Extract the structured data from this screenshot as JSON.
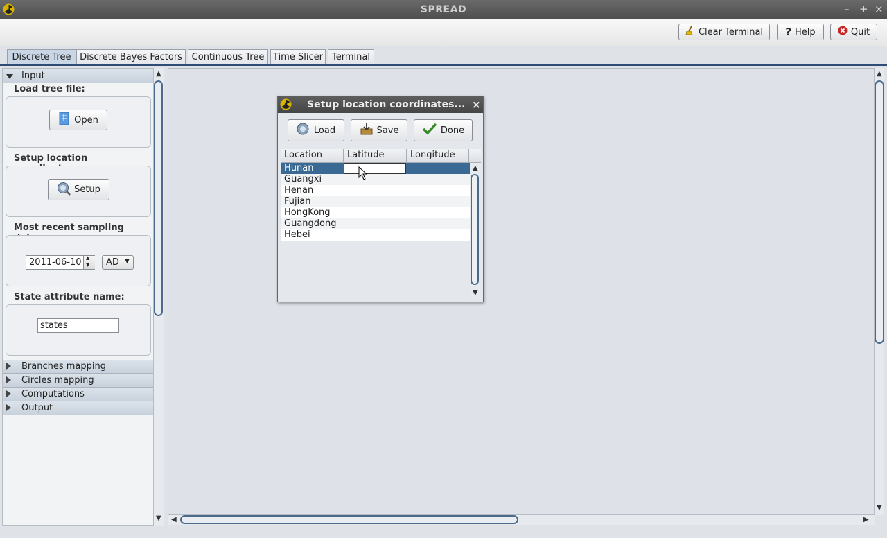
{
  "window": {
    "title": "SPREAD",
    "controls": [
      "–",
      "+",
      "×"
    ]
  },
  "toolbar": {
    "clear_terminal": "Clear Terminal",
    "help": "Help",
    "quit": "Quit"
  },
  "tabs": [
    {
      "label": "Discrete Tree",
      "active": true
    },
    {
      "label": "Discrete Bayes Factors",
      "active": false
    },
    {
      "label": "Continuous Tree",
      "active": false
    },
    {
      "label": "Time Slicer",
      "active": false
    },
    {
      "label": "Terminal",
      "active": false
    }
  ],
  "left_panel": {
    "input_header": "Input",
    "load_tree_label": "Load tree file:",
    "open_button": "Open",
    "setup_coords_label": "Setup location coordinates:",
    "setup_button": "Setup",
    "sampling_date_label": "Most recent sampling date:",
    "sampling_date_value": "2011-06-10",
    "era_value": "AD",
    "state_attr_label": "State attribute name:",
    "state_attr_value": "states",
    "collapsed_sections": [
      "Branches mapping",
      "Circles mapping",
      "Computations",
      "Output"
    ]
  },
  "dialog": {
    "title": "Setup location coordinates...",
    "close": "×",
    "buttons": {
      "load": "Load",
      "save": "Save",
      "done": "Done"
    },
    "columns": [
      "Location",
      "Latitude",
      "Longitude"
    ],
    "rows": [
      {
        "location": "Hunan",
        "latitude": "",
        "longitude": "",
        "selected": true
      },
      {
        "location": "Guangxi",
        "latitude": "",
        "longitude": ""
      },
      {
        "location": "Henan",
        "latitude": "",
        "longitude": ""
      },
      {
        "location": "Fujian",
        "latitude": "",
        "longitude": ""
      },
      {
        "location": "HongKong",
        "latitude": "",
        "longitude": ""
      },
      {
        "location": "Guangdong",
        "latitude": "",
        "longitude": ""
      },
      {
        "location": "Hebei",
        "latitude": "",
        "longitude": ""
      }
    ]
  },
  "colors": {
    "selection": "#3a6a94",
    "tab_underline": "#2f4d74",
    "title_bar": "#555555"
  }
}
